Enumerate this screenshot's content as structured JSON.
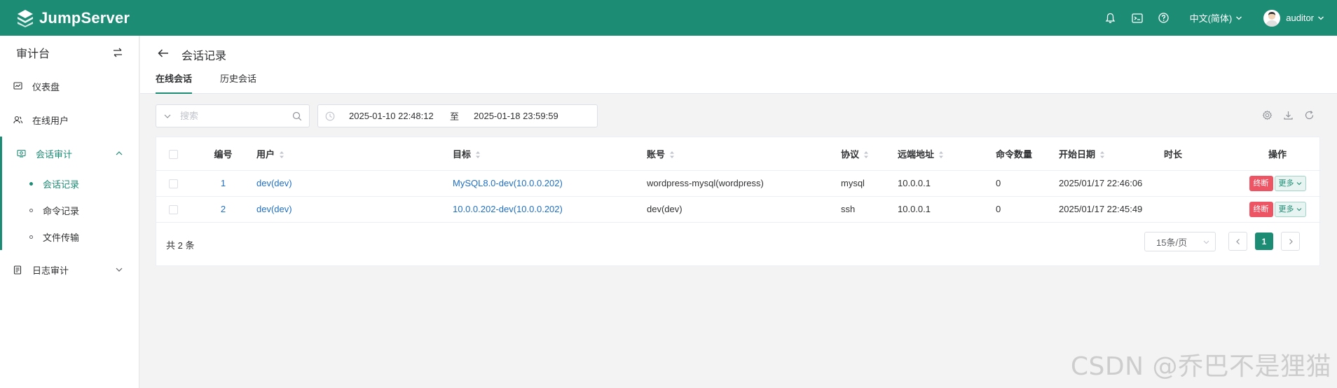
{
  "app": {
    "name": "JumpServer"
  },
  "topbar": {
    "language": "中文(简体)",
    "username": "auditor"
  },
  "sidebar": {
    "title": "审计台",
    "items": [
      {
        "label": "仪表盘"
      },
      {
        "label": "在线用户"
      },
      {
        "label": "会话审计"
      },
      {
        "label": "日志审计"
      }
    ],
    "subitems": [
      {
        "label": "会话记录"
      },
      {
        "label": "命令记录"
      },
      {
        "label": "文件传输"
      }
    ]
  },
  "page": {
    "title": "会话记录",
    "tabs": [
      {
        "label": "在线会话"
      },
      {
        "label": "历史会话"
      }
    ]
  },
  "toolbar": {
    "search_placeholder": "搜索",
    "date_start": "2025-01-10 22:48:12",
    "date_separator": "至",
    "date_end": "2025-01-18 23:59:59"
  },
  "table": {
    "columns": [
      "编号",
      "用户",
      "目标",
      "账号",
      "协议",
      "远端地址",
      "命令数量",
      "开始日期",
      "时长",
      "操作"
    ],
    "rows": [
      {
        "id": "1",
        "user": "dev(dev)",
        "target": "MySQL8.0-dev(10.0.0.202)",
        "account": "wordpress-mysql(wordpress)",
        "protocol": "mysql",
        "remote": "10.0.0.1",
        "commands": "0",
        "start": "2025/01/17 22:46:06",
        "duration": ""
      },
      {
        "id": "2",
        "user": "dev(dev)",
        "target": "10.0.0.202-dev(10.0.0.202)",
        "account": "dev(dev)",
        "protocol": "ssh",
        "remote": "10.0.0.1",
        "commands": "0",
        "start": "2025/01/17 22:45:49",
        "duration": ""
      }
    ],
    "action_stop": "终断",
    "action_more": "更多"
  },
  "pagination": {
    "total": "共 2 条",
    "page_size": "15条/页",
    "current_page": "1"
  },
  "watermark": "CSDN @乔巴不是狸猫",
  "colors": {
    "brand": "#1c8c74",
    "danger": "#ed5565",
    "link": "#1f6fc2"
  }
}
